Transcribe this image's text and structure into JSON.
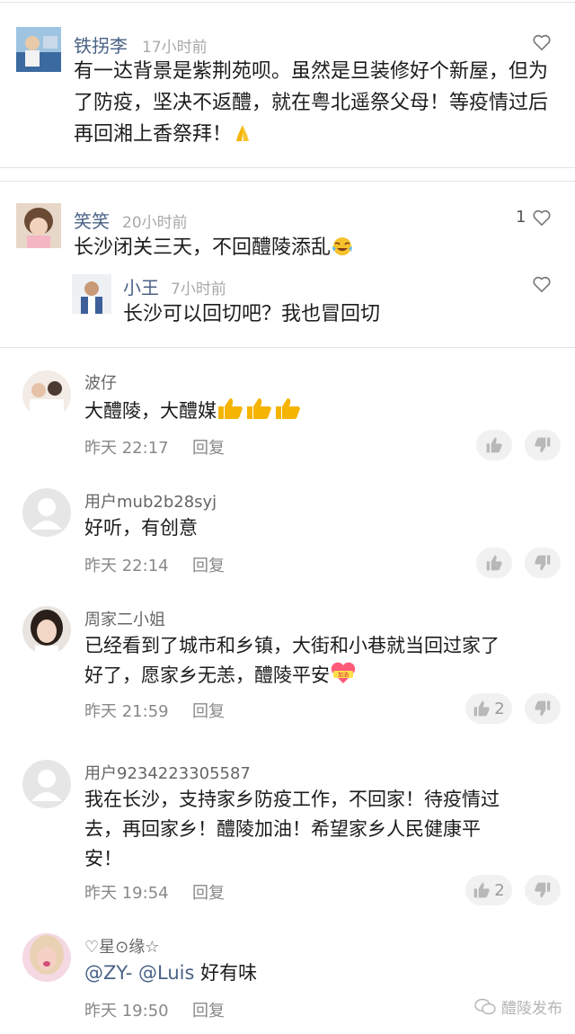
{
  "section1": {
    "comments": [
      {
        "name": "铁拐李",
        "time": "17小时前",
        "text": "有一达背景是紫荆苑呗。虽然是旦装修好个新屋，但为了防疫，坚决不返醴，就在粤北遥祭父母！等疫情过后再回湘上香祭拜！",
        "emoji": "pray",
        "likes": ""
      },
      {
        "name": "笑笑",
        "time": "20小时前",
        "text": "长沙闭关三天，不回醴陵添乱",
        "emoji": "laugh-cry",
        "likes": "1",
        "reply": {
          "name": "小王",
          "time": "7小时前",
          "text": "长沙可以回切吧？我也冒回切"
        }
      }
    ]
  },
  "section2": {
    "reply_label": "回复",
    "comments": [
      {
        "name": "波仔",
        "text": "大醴陵，大醴媒",
        "emoji": "thumbs-up-x3",
        "time": "昨天 22:17",
        "likes": ""
      },
      {
        "name": "用户mub2b28syj",
        "text": "好听，有创意",
        "time": "昨天 22:14",
        "likes": ""
      },
      {
        "name": "周家二小姐",
        "text_line1": "已经看到了城市和乡镇，大街和小巷就当回过家了",
        "text_line2": "好了，愿家乡无恙，醴陵平安",
        "emoji": "jiayou-heart",
        "emoji_text": "加油",
        "time": "昨天 21:59",
        "likes": "2"
      },
      {
        "name": "用户9234223305587",
        "text_line1": "我在长沙，支持家乡防疫工作，不回家！待疫情过",
        "text_line2": "去，再回家乡！醴陵加油！希望家乡人民健康平",
        "text_line3": "安！",
        "time": "昨天 19:54",
        "likes": "2"
      },
      {
        "name": "♡星⊙缘☆",
        "mention1": "@ZY-",
        "mention2": "@Luis",
        "text": " 好有味",
        "time": "昨天 19:50",
        "likes": ""
      }
    ]
  },
  "watermark": {
    "text": "醴陵发布",
    "icon": "wechat-icon"
  },
  "colors": {
    "username_blue": "#4a6286",
    "thumb_orange": "#f5b400",
    "heart_red": "#ff5a7a"
  }
}
